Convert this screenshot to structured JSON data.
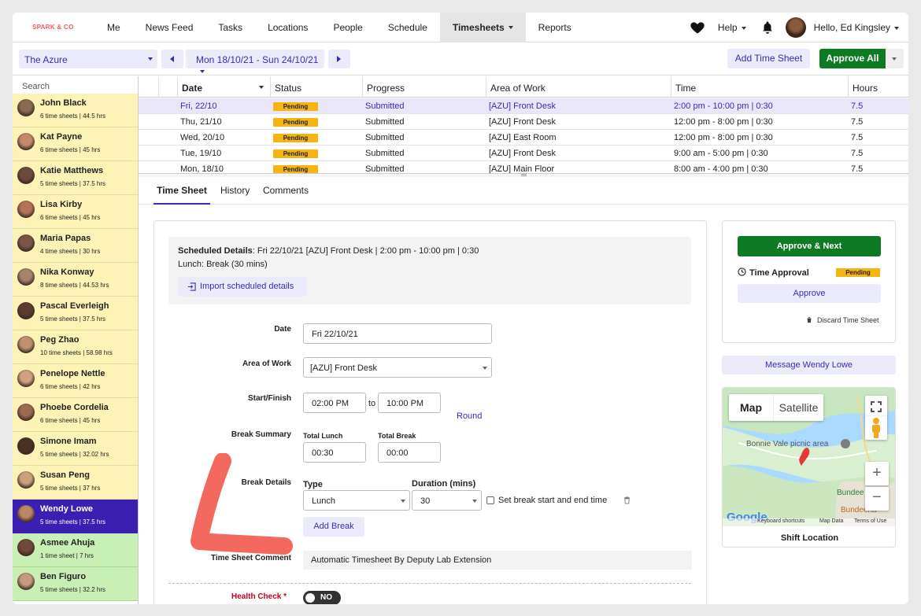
{
  "brand": {
    "logo": "SPARK & CO"
  },
  "nav": {
    "items": [
      {
        "label": "Me",
        "x": 0
      },
      {
        "label": "News Feed"
      },
      {
        "label": "Tasks"
      },
      {
        "label": "Locations"
      },
      {
        "label": "People"
      },
      {
        "label": "Schedule"
      },
      {
        "label": "Timesheets"
      },
      {
        "label": "Reports"
      }
    ],
    "help": "Help",
    "hello": "Hello, Ed Kingsley"
  },
  "toolbar": {
    "location": "The Azure",
    "date_range": "Mon 18/10/21 - Sun 24/10/21",
    "add_timesheet": "Add Time Sheet",
    "approve_all": "Approve All"
  },
  "sidebar": {
    "search_placeholder": "Search",
    "employees": [
      {
        "name": "John Black",
        "detail": "6 time sheets | 44.5 hrs",
        "state": "pending"
      },
      {
        "name": "Kat Payne",
        "detail": "6 time sheets | 45 hrs",
        "state": "pending"
      },
      {
        "name": "Katie Matthews",
        "detail": "5 time sheets | 37.5 hrs",
        "state": "pending"
      },
      {
        "name": "Lisa Kirby",
        "detail": "6 time sheets | 45 hrs",
        "state": "pending"
      },
      {
        "name": "Maria Papas",
        "detail": "4 time sheets | 30 hrs",
        "state": "pending"
      },
      {
        "name": "Nika Konway",
        "detail": "8 time sheets | 44.53 hrs",
        "state": "pending"
      },
      {
        "name": "Pascal Everleigh",
        "detail": "5 time sheets | 37.5 hrs",
        "state": "pending"
      },
      {
        "name": "Peg Zhao",
        "detail": "10 time sheets | 58.98 hrs",
        "state": "pending"
      },
      {
        "name": "Penelope Nettle",
        "detail": "6 time sheets | 42 hrs",
        "state": "pending"
      },
      {
        "name": "Phoebe Cordelia",
        "detail": "6 time sheets | 45 hrs",
        "state": "pending"
      },
      {
        "name": "Simone Imam",
        "detail": "5 time sheets | 32.02 hrs",
        "state": "pending"
      },
      {
        "name": "Susan Peng",
        "detail": "5 time sheets | 37 hrs",
        "state": "pending"
      },
      {
        "name": "Wendy Lowe",
        "detail": "5 time sheets | 37.5 hrs",
        "state": "selected"
      },
      {
        "name": "Asmee Ahuja",
        "detail": "1 time sheet | 7 hrs",
        "state": "approved"
      },
      {
        "name": "Ben Figuro",
        "detail": "5 time sheets | 32.2 hrs",
        "state": "approved"
      }
    ]
  },
  "grid": {
    "headers": {
      "date": "Date",
      "status": "Status",
      "progress": "Progress",
      "area": "Area of Work",
      "time": "Time",
      "hours": "Hours"
    },
    "rows": [
      {
        "date": "Fri, 22/10",
        "status": "Pending",
        "progress": "Submitted",
        "area": "[AZU] Front Desk",
        "time": "2:00 pm - 10:00 pm | 0:30",
        "hours": "7.5"
      },
      {
        "date": "Thu, 21/10",
        "status": "Pending",
        "progress": "Submitted",
        "area": "[AZU] Front Desk",
        "time": "12:00 pm - 8:00 pm | 0:30",
        "hours": "7.5"
      },
      {
        "date": "Wed, 20/10",
        "status": "Pending",
        "progress": "Submitted",
        "area": "[AZU] East Room",
        "time": "12:00 pm - 8:00 pm | 0:30",
        "hours": "7.5"
      },
      {
        "date": "Tue, 19/10",
        "status": "Pending",
        "progress": "Submitted",
        "area": "[AZU] Front Desk",
        "time": "9:00 am - 5:00 pm | 0:30",
        "hours": "7.5"
      },
      {
        "date": "Mon, 18/10",
        "status": "Pending",
        "progress": "Submitted",
        "area": "[AZU] Main Floor",
        "time": "8:00 am - 4:00 pm | 0:30",
        "hours": "7.5"
      }
    ]
  },
  "tabs": [
    "Time Sheet",
    "History",
    "Comments"
  ],
  "form": {
    "scheduled_label": "Scheduled Details",
    "scheduled_value": ": Fri 22/10/21 [AZU] Front Desk | 2:00 pm - 10:00 pm | 0:30",
    "lunch_line": "Lunch: Break (30 mins)",
    "import_label": "Import scheduled details",
    "date_label": "Date",
    "date_value": "Fri 22/10/21",
    "area_label": "Area of Work",
    "area_value": "[AZU] Front Desk",
    "startfinish_label": "Start/Finish",
    "start_value": "02:00 PM",
    "to_text": "to",
    "finish_value": "10:00 PM",
    "round_label": "Round",
    "break_summary_label": "Break Summary",
    "total_lunch_label": "Total Lunch",
    "total_lunch_value": "00:30",
    "total_break_label": "Total Break",
    "total_break_value": "00:00",
    "break_details_label": "Break Details",
    "type_label": "Type",
    "type_value": "Lunch",
    "duration_label": "Duration (mins)",
    "duration_value": "30",
    "set_break_label": "Set break start and end time",
    "add_break_label": "Add Break",
    "comment_label": "Time Sheet Comment",
    "comment_value": "Automatic Timesheet By Deputy Lab Extension",
    "health_label": "Health Check *",
    "health_toggle": "NO"
  },
  "approval": {
    "approve_next": "Approve & Next",
    "time_approval_label": "Time Approval",
    "status": "Pending",
    "approve": "Approve",
    "discard": "Discard Time Sheet",
    "message": "Message Wendy Lowe"
  },
  "map": {
    "map_tab": "Map",
    "satellite_tab": "Satellite",
    "place_label": "Bonnie Vale picnic area",
    "place_label2": "Bundee",
    "place_label3": "Bundeena",
    "logo": "Google",
    "footer_shortcuts": "Keyboard shortcuts",
    "footer_data": "Map Data",
    "footer_terms": "Terms of Use",
    "caption": "Shift Location"
  },
  "colors": {
    "accent": "#3b2bb3",
    "approve_green": "#0e7a23",
    "pending": "#f5b40f",
    "pending_row": "#fdf3b6",
    "approved_row": "#c9f0b4",
    "annotation": "#f4695f"
  }
}
